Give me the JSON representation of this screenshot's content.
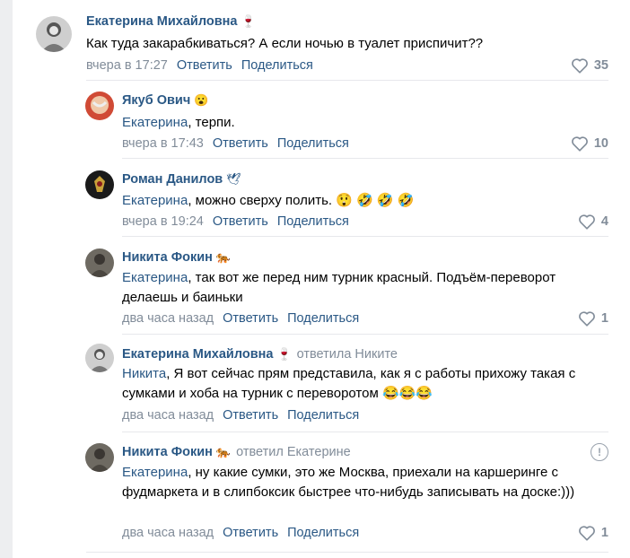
{
  "comments": [
    {
      "author": "Екатерина Михайловна",
      "badge": "🍷",
      "reply_to": "",
      "mention": "",
      "text": "Как туда закарабкиваться? А если ночью в туалет приспичит??",
      "time": "вчера в 17:27",
      "reply_label": "Ответить",
      "share_label": "Поделиться",
      "likes": "35"
    },
    {
      "author": "Якуб Ович",
      "badge": "😮",
      "reply_to": "",
      "mention": "Екатерина",
      "text": ", терпи.",
      "time": "вчера в 17:43",
      "reply_label": "Ответить",
      "share_label": "Поделиться",
      "likes": "10"
    },
    {
      "author": "Роман Данилов",
      "badge": "🕊",
      "reply_to": "",
      "mention": "Екатерина",
      "text": ", можно сверху полить. 😲 🤣 🤣 🤣",
      "time": "вчера в 19:24",
      "reply_label": "Ответить",
      "share_label": "Поделиться",
      "likes": "4"
    },
    {
      "author": "Никита Фокин",
      "badge": "🐅",
      "reply_to": "",
      "mention": "Екатерина",
      "text": ", так вот же перед ним турник красный. Подъём-переворот делаешь и баиньки",
      "time": "два часа назад",
      "reply_label": "Ответить",
      "share_label": "Поделиться",
      "likes": "1"
    },
    {
      "author": "Екатерина Михайловна",
      "badge": "🍷",
      "reply_to": "ответила Никите",
      "mention": "Никита",
      "text": ", Я вот сейчас прям представила, как я с работы прихожу такая с сумками и хоба на турник с переворотом 😂😂😂",
      "time": "два часа назад",
      "reply_label": "Ответить",
      "share_label": "Поделиться",
      "likes": ""
    },
    {
      "author": "Никита Фокин",
      "badge": "🐅",
      "reply_to": "ответил Екатерине",
      "mention": "Екатерина",
      "text": ", ну какие сумки, это же Москва, приехали на каршеринге с фудмаркета и в слипбоксик быстрее что-нибудь записывать на доске:)))",
      "time": "два часа назад",
      "reply_label": "Ответить",
      "share_label": "Поделиться",
      "likes": "1"
    }
  ],
  "report_symbol": "!",
  "colors": {
    "link": "#2a5885",
    "meta": "#818c99",
    "background_strip": "#edeef0"
  }
}
